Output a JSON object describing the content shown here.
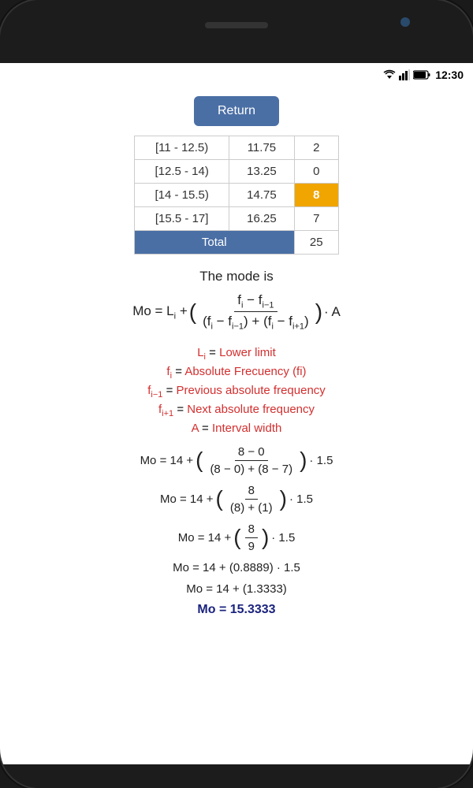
{
  "status": {
    "time": "12:30"
  },
  "button": {
    "return_label": "Return"
  },
  "table": {
    "rows": [
      {
        "interval": "[11 - 12.5)",
        "midpoint": "11.75",
        "freq": "2",
        "highlighted": false
      },
      {
        "interval": "[12.5 - 14)",
        "midpoint": "13.25",
        "freq": "0",
        "highlighted": false
      },
      {
        "interval": "[14 - 15.5)",
        "midpoint": "14.75",
        "freq": "8",
        "highlighted": true
      },
      {
        "interval": "[15.5 - 17]",
        "midpoint": "16.25",
        "freq": "7",
        "highlighted": false
      }
    ],
    "total_label": "Total",
    "total_value": "25"
  },
  "mode_section": {
    "title": "The mode is",
    "formula_label": "Mo = L",
    "legend": [
      {
        "var": "Lᵢ",
        "separator": "=",
        "desc": "Lower limit"
      },
      {
        "var": "fᵢ",
        "separator": "=",
        "desc": "Absolute Frecuency (fi)"
      },
      {
        "var": "fᵢ₋₁",
        "separator": "=",
        "desc": "Previous absolute frequency"
      },
      {
        "var": "fᵢ₊₁",
        "separator": "=",
        "desc": "Next absolute frequency"
      },
      {
        "var": "A",
        "separator": "=",
        "desc": "Interval width"
      }
    ],
    "calculations": [
      "Mo = 14 + ((8 − 0) / ((8 − 0) + (8 − 7))) · 1.5",
      "Mo = 14 + (8 / ((8) + (1))) · 1.5",
      "Mo = 14 + (8/9) · 1.5",
      "Mo = 14 + (0.8889) · 1.5",
      "Mo = 14 + (1.3333)",
      "Mo = 15.3333"
    ]
  }
}
